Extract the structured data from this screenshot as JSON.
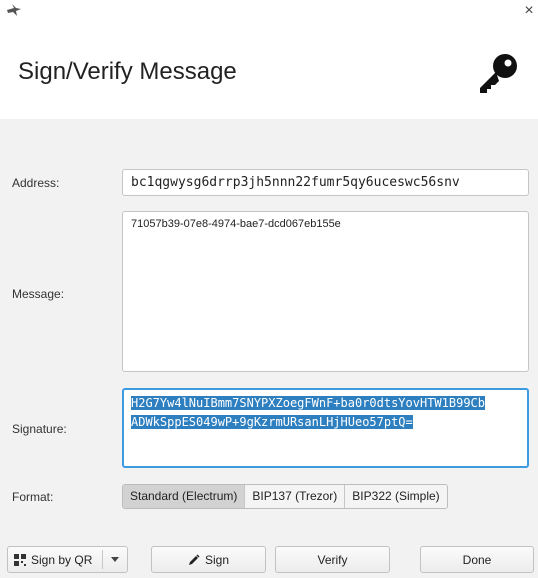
{
  "header": {
    "title": "Sign/Verify Message",
    "close_glyph": "×",
    "app_icon": "sparrow-bird-icon",
    "key_icon": "key-icon"
  },
  "form": {
    "address_label": "Address:",
    "address_value": "bc1qgwysg6drrp3jh5nnn22fumr5qy6uceswc56snv",
    "message_label": "Message:",
    "message_value": "71057b39-07e8-4974-bae7-dcd067eb155e",
    "signature_label": "Signature:",
    "signature_line1": "H2G7Yw4lNuIBmm7SNYPXZoegFWnF+ba0r0dtsYovHTW1B99Cb",
    "signature_line2": "ADWkSppES049wP+9gKzrmURsanLHjHUeo57ptQ=",
    "format_label": "Format:",
    "formats": [
      "Standard (Electrum)",
      "BIP137 (Trezor)",
      "BIP322 (Simple)"
    ],
    "selected_format": "Standard (Electrum)"
  },
  "footer": {
    "sign_by_qr_label": "Sign by QR",
    "sign_label": "Sign",
    "verify_label": "Verify",
    "done_label": "Done"
  },
  "colors": {
    "accent": "#3d9be0",
    "selection": "#2d7fc0"
  }
}
